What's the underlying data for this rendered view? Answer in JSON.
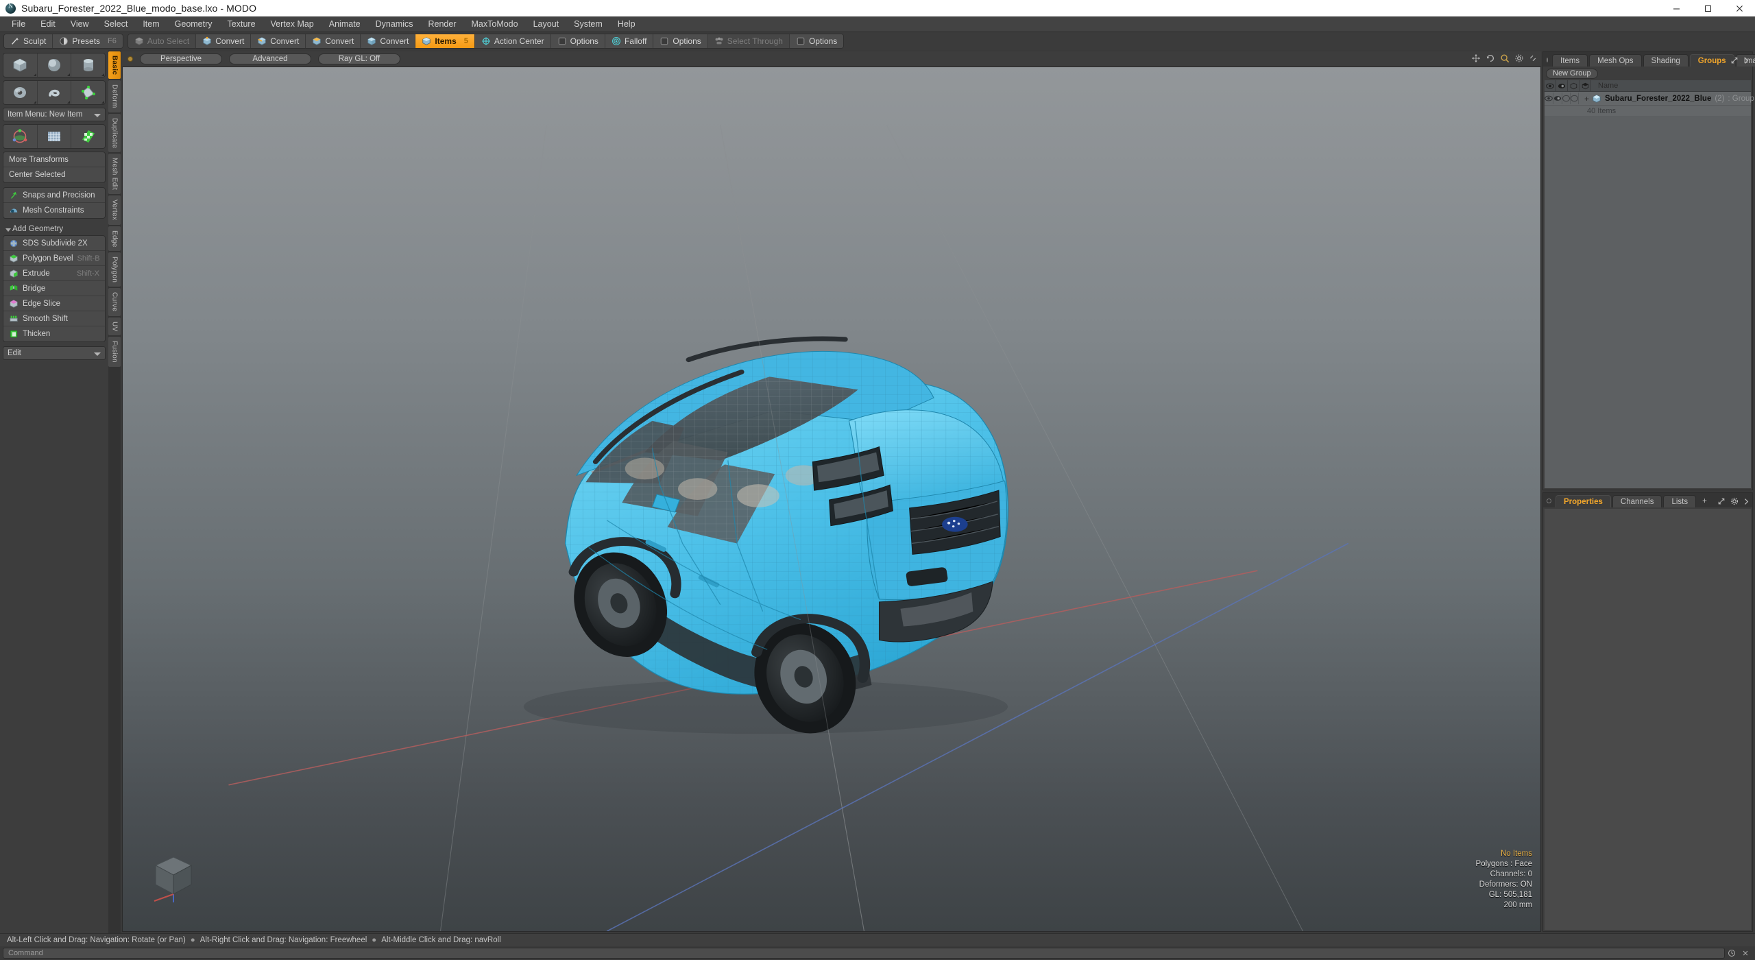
{
  "window": {
    "title": "Subaru_Forester_2022_Blue_modo_base.lxo - MODO",
    "app_icon": "modo-logo-icon",
    "controls": [
      "minimize",
      "maximize",
      "close"
    ]
  },
  "menubar": {
    "items": [
      "File",
      "Edit",
      "View",
      "Select",
      "Item",
      "Geometry",
      "Texture",
      "Vertex Map",
      "Animate",
      "Dynamics",
      "Render",
      "MaxToModo",
      "Layout",
      "System",
      "Help"
    ]
  },
  "modebar": {
    "left_group": [
      {
        "label": "Sculpt",
        "icon": "brush-icon",
        "state": "normal"
      },
      {
        "label": "Presets",
        "icon": "sphere-icon",
        "shortcut": "F6",
        "state": "normal"
      }
    ],
    "main_group": [
      {
        "label": "Auto Select",
        "icon": "cube-gray-icon",
        "state": "disabled"
      },
      {
        "label": "Convert",
        "icon": "cube-vertex-icon",
        "state": "normal"
      },
      {
        "label": "Convert",
        "icon": "cube-edge-icon",
        "state": "normal"
      },
      {
        "label": "Convert",
        "icon": "cube-polygon-icon",
        "state": "normal"
      },
      {
        "label": "Convert",
        "icon": "cube-material-icon",
        "state": "normal"
      },
      {
        "label": "Items",
        "icon": "cube-items-icon",
        "state": "active",
        "shortcut": "5"
      },
      {
        "label": "Action Center",
        "icon": "target-icon",
        "state": "normal"
      },
      {
        "label": "Options",
        "icon": "square-icon",
        "state": "normal"
      },
      {
        "label": "Falloff",
        "icon": "falloff-icon",
        "state": "normal"
      },
      {
        "label": "Options",
        "icon": "square-icon",
        "state": "normal"
      },
      {
        "label": "Select Through",
        "icon": "select-through-icon",
        "state": "disabled"
      },
      {
        "label": "Options",
        "icon": "square-icon",
        "state": "normal"
      }
    ]
  },
  "left_panel": {
    "primitive_icons": [
      "cube-icon",
      "sphere-icon",
      "cylinder-icon",
      "torus-icon",
      "spiral-icon",
      "polygon-icon"
    ],
    "item_menu": {
      "label": "Item Menu: New Item"
    },
    "transform_icons": [
      "transform-gizmo-icon",
      "mesh-grid-icon",
      "checker-material-icon",
      "falloff-cone-icon"
    ],
    "transform_buttons": [
      "More Transforms",
      "Center Selected"
    ],
    "snap_items": [
      {
        "label": "Snaps and Precision",
        "icon": "snap-arrow-icon"
      },
      {
        "label": "Mesh Constraints",
        "icon": "mesh-constraint-icon"
      }
    ],
    "add_geometry": {
      "title": "Add Geometry",
      "items": [
        {
          "label": "SDS Subdivide 2X",
          "shortcut": "",
          "icon": "sds-icon"
        },
        {
          "label": "Polygon Bevel",
          "shortcut": "Shift-B",
          "icon": "bevel-icon"
        },
        {
          "label": "Extrude",
          "shortcut": "Shift-X",
          "icon": "extrude-icon"
        },
        {
          "label": "Bridge",
          "shortcut": "",
          "icon": "bridge-icon"
        },
        {
          "label": "Edge Slice",
          "shortcut": "",
          "icon": "edge-slice-icon"
        },
        {
          "label": "Smooth Shift",
          "shortcut": "",
          "icon": "smooth-shift-icon"
        },
        {
          "label": "Thicken",
          "shortcut": "",
          "icon": "thicken-icon"
        }
      ]
    },
    "edit_dropdown": {
      "label": "Edit"
    },
    "vertical_tabs": [
      {
        "label": "Basic",
        "active": true
      },
      {
        "label": "Deform",
        "active": false
      },
      {
        "label": "Duplicate",
        "active": false
      },
      {
        "label": "Mesh Edit",
        "active": false
      },
      {
        "label": "Vertex",
        "active": false
      },
      {
        "label": "Edge",
        "active": false
      },
      {
        "label": "Polygon",
        "active": false
      },
      {
        "label": "Curve",
        "active": false
      },
      {
        "label": "UV",
        "active": false
      },
      {
        "label": "Fusion",
        "active": false
      }
    ]
  },
  "viewport": {
    "header": {
      "menu_dot": "viewport-menu-dot",
      "pills": [
        "Perspective",
        "Advanced",
        "Ray GL: Off"
      ],
      "right_icons": [
        "move-view-icon",
        "rotate-view-icon",
        "zoom-view-icon",
        "settings-icon",
        "expand-icon"
      ]
    },
    "stats": {
      "selection": "No Items",
      "polygons": "Polygons : Face",
      "channels": "Channels: 0",
      "deformers": "Deformers: ON",
      "gl": "GL: 505,181",
      "scale": "200 mm"
    },
    "model": {
      "name": "Subaru Forester 2022",
      "body_color": "#4cc0e8",
      "wireframe": true
    }
  },
  "right_panel": {
    "top_tabs": [
      {
        "label": "Items",
        "active": false
      },
      {
        "label": "Mesh Ops",
        "active": false
      },
      {
        "label": "Shading",
        "active": false
      },
      {
        "label": "Groups",
        "active": true
      },
      {
        "label": "Images",
        "active": false
      },
      {
        "label": "+",
        "active": false
      }
    ],
    "new_group_button": "New Group",
    "tree": {
      "columns": [
        "visibility-eye-icon",
        "render-eye-icon",
        "wireframe-icon",
        "shaded-icon",
        "Name"
      ],
      "rows": [
        {
          "name": "Subaru_Forester_2022_Blue",
          "count": "(2)",
          "type": ": Group",
          "sub": "40 Items",
          "expander": "+"
        }
      ]
    },
    "bottom_tabs": [
      {
        "label": "Properties",
        "active": true
      },
      {
        "label": "Channels",
        "active": false
      },
      {
        "label": "Lists",
        "active": false
      },
      {
        "label": "+",
        "active": false
      }
    ]
  },
  "statusbar": {
    "hints": [
      "Alt-Left Click and Drag: Navigation: Rotate (or Pan)",
      "Alt-Right Click and Drag: Navigation: Freewheel",
      "Alt-Middle Click and Drag: navRoll"
    ]
  },
  "commandbar": {
    "placeholder": "Command",
    "right_icons": [
      "history-icon",
      "clear-icon"
    ]
  },
  "colors": {
    "accent": "#f0a52b",
    "model_blue": "#4cc0e8",
    "panel_bg": "#3d3d3d",
    "tree_bg": "#5d6062"
  }
}
